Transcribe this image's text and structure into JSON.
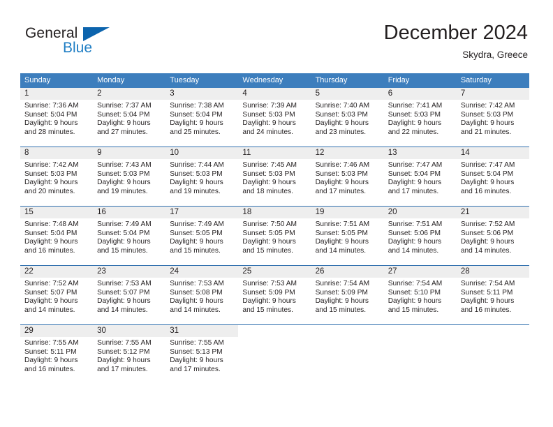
{
  "brand": {
    "word_one": "General",
    "word_two": "Blue",
    "mark": "triangle-logo-icon",
    "accent_color": "#0c64ad",
    "blue_text_color": "#1f7ec4"
  },
  "header": {
    "title": "December 2024",
    "subtitle": "Skydra, Greece"
  },
  "theme": {
    "header_row_bg": "#3d7ebd",
    "day_band_bg": "#eeeeee",
    "row_divider": "#2f6fae",
    "text": "#231f20"
  },
  "weekday_headers": [
    "Sunday",
    "Monday",
    "Tuesday",
    "Wednesday",
    "Thursday",
    "Friday",
    "Saturday"
  ],
  "weeks": [
    [
      {
        "day": "1",
        "sunrise": "Sunrise: 7:36 AM",
        "sunset": "Sunset: 5:04 PM",
        "daylight1": "Daylight: 9 hours",
        "daylight2": "and 28 minutes."
      },
      {
        "day": "2",
        "sunrise": "Sunrise: 7:37 AM",
        "sunset": "Sunset: 5:04 PM",
        "daylight1": "Daylight: 9 hours",
        "daylight2": "and 27 minutes."
      },
      {
        "day": "3",
        "sunrise": "Sunrise: 7:38 AM",
        "sunset": "Sunset: 5:04 PM",
        "daylight1": "Daylight: 9 hours",
        "daylight2": "and 25 minutes."
      },
      {
        "day": "4",
        "sunrise": "Sunrise: 7:39 AM",
        "sunset": "Sunset: 5:03 PM",
        "daylight1": "Daylight: 9 hours",
        "daylight2": "and 24 minutes."
      },
      {
        "day": "5",
        "sunrise": "Sunrise: 7:40 AM",
        "sunset": "Sunset: 5:03 PM",
        "daylight1": "Daylight: 9 hours",
        "daylight2": "and 23 minutes."
      },
      {
        "day": "6",
        "sunrise": "Sunrise: 7:41 AM",
        "sunset": "Sunset: 5:03 PM",
        "daylight1": "Daylight: 9 hours",
        "daylight2": "and 22 minutes."
      },
      {
        "day": "7",
        "sunrise": "Sunrise: 7:42 AM",
        "sunset": "Sunset: 5:03 PM",
        "daylight1": "Daylight: 9 hours",
        "daylight2": "and 21 minutes."
      }
    ],
    [
      {
        "day": "8",
        "sunrise": "Sunrise: 7:42 AM",
        "sunset": "Sunset: 5:03 PM",
        "daylight1": "Daylight: 9 hours",
        "daylight2": "and 20 minutes."
      },
      {
        "day": "9",
        "sunrise": "Sunrise: 7:43 AM",
        "sunset": "Sunset: 5:03 PM",
        "daylight1": "Daylight: 9 hours",
        "daylight2": "and 19 minutes."
      },
      {
        "day": "10",
        "sunrise": "Sunrise: 7:44 AM",
        "sunset": "Sunset: 5:03 PM",
        "daylight1": "Daylight: 9 hours",
        "daylight2": "and 19 minutes."
      },
      {
        "day": "11",
        "sunrise": "Sunrise: 7:45 AM",
        "sunset": "Sunset: 5:03 PM",
        "daylight1": "Daylight: 9 hours",
        "daylight2": "and 18 minutes."
      },
      {
        "day": "12",
        "sunrise": "Sunrise: 7:46 AM",
        "sunset": "Sunset: 5:03 PM",
        "daylight1": "Daylight: 9 hours",
        "daylight2": "and 17 minutes."
      },
      {
        "day": "13",
        "sunrise": "Sunrise: 7:47 AM",
        "sunset": "Sunset: 5:04 PM",
        "daylight1": "Daylight: 9 hours",
        "daylight2": "and 17 minutes."
      },
      {
        "day": "14",
        "sunrise": "Sunrise: 7:47 AM",
        "sunset": "Sunset: 5:04 PM",
        "daylight1": "Daylight: 9 hours",
        "daylight2": "and 16 minutes."
      }
    ],
    [
      {
        "day": "15",
        "sunrise": "Sunrise: 7:48 AM",
        "sunset": "Sunset: 5:04 PM",
        "daylight1": "Daylight: 9 hours",
        "daylight2": "and 16 minutes."
      },
      {
        "day": "16",
        "sunrise": "Sunrise: 7:49 AM",
        "sunset": "Sunset: 5:04 PM",
        "daylight1": "Daylight: 9 hours",
        "daylight2": "and 15 minutes."
      },
      {
        "day": "17",
        "sunrise": "Sunrise: 7:49 AM",
        "sunset": "Sunset: 5:05 PM",
        "daylight1": "Daylight: 9 hours",
        "daylight2": "and 15 minutes."
      },
      {
        "day": "18",
        "sunrise": "Sunrise: 7:50 AM",
        "sunset": "Sunset: 5:05 PM",
        "daylight1": "Daylight: 9 hours",
        "daylight2": "and 15 minutes."
      },
      {
        "day": "19",
        "sunrise": "Sunrise: 7:51 AM",
        "sunset": "Sunset: 5:05 PM",
        "daylight1": "Daylight: 9 hours",
        "daylight2": "and 14 minutes."
      },
      {
        "day": "20",
        "sunrise": "Sunrise: 7:51 AM",
        "sunset": "Sunset: 5:06 PM",
        "daylight1": "Daylight: 9 hours",
        "daylight2": "and 14 minutes."
      },
      {
        "day": "21",
        "sunrise": "Sunrise: 7:52 AM",
        "sunset": "Sunset: 5:06 PM",
        "daylight1": "Daylight: 9 hours",
        "daylight2": "and 14 minutes."
      }
    ],
    [
      {
        "day": "22",
        "sunrise": "Sunrise: 7:52 AM",
        "sunset": "Sunset: 5:07 PM",
        "daylight1": "Daylight: 9 hours",
        "daylight2": "and 14 minutes."
      },
      {
        "day": "23",
        "sunrise": "Sunrise: 7:53 AM",
        "sunset": "Sunset: 5:07 PM",
        "daylight1": "Daylight: 9 hours",
        "daylight2": "and 14 minutes."
      },
      {
        "day": "24",
        "sunrise": "Sunrise: 7:53 AM",
        "sunset": "Sunset: 5:08 PM",
        "daylight1": "Daylight: 9 hours",
        "daylight2": "and 14 minutes."
      },
      {
        "day": "25",
        "sunrise": "Sunrise: 7:53 AM",
        "sunset": "Sunset: 5:09 PM",
        "daylight1": "Daylight: 9 hours",
        "daylight2": "and 15 minutes."
      },
      {
        "day": "26",
        "sunrise": "Sunrise: 7:54 AM",
        "sunset": "Sunset: 5:09 PM",
        "daylight1": "Daylight: 9 hours",
        "daylight2": "and 15 minutes."
      },
      {
        "day": "27",
        "sunrise": "Sunrise: 7:54 AM",
        "sunset": "Sunset: 5:10 PM",
        "daylight1": "Daylight: 9 hours",
        "daylight2": "and 15 minutes."
      },
      {
        "day": "28",
        "sunrise": "Sunrise: 7:54 AM",
        "sunset": "Sunset: 5:11 PM",
        "daylight1": "Daylight: 9 hours",
        "daylight2": "and 16 minutes."
      }
    ],
    [
      {
        "day": "29",
        "sunrise": "Sunrise: 7:55 AM",
        "sunset": "Sunset: 5:11 PM",
        "daylight1": "Daylight: 9 hours",
        "daylight2": "and 16 minutes."
      },
      {
        "day": "30",
        "sunrise": "Sunrise: 7:55 AM",
        "sunset": "Sunset: 5:12 PM",
        "daylight1": "Daylight: 9 hours",
        "daylight2": "and 17 minutes."
      },
      {
        "day": "31",
        "sunrise": "Sunrise: 7:55 AM",
        "sunset": "Sunset: 5:13 PM",
        "daylight1": "Daylight: 9 hours",
        "daylight2": "and 17 minutes."
      },
      {
        "day": "",
        "sunrise": "",
        "sunset": "",
        "daylight1": "",
        "daylight2": ""
      },
      {
        "day": "",
        "sunrise": "",
        "sunset": "",
        "daylight1": "",
        "daylight2": ""
      },
      {
        "day": "",
        "sunrise": "",
        "sunset": "",
        "daylight1": "",
        "daylight2": ""
      },
      {
        "day": "",
        "sunrise": "",
        "sunset": "",
        "daylight1": "",
        "daylight2": ""
      }
    ]
  ]
}
